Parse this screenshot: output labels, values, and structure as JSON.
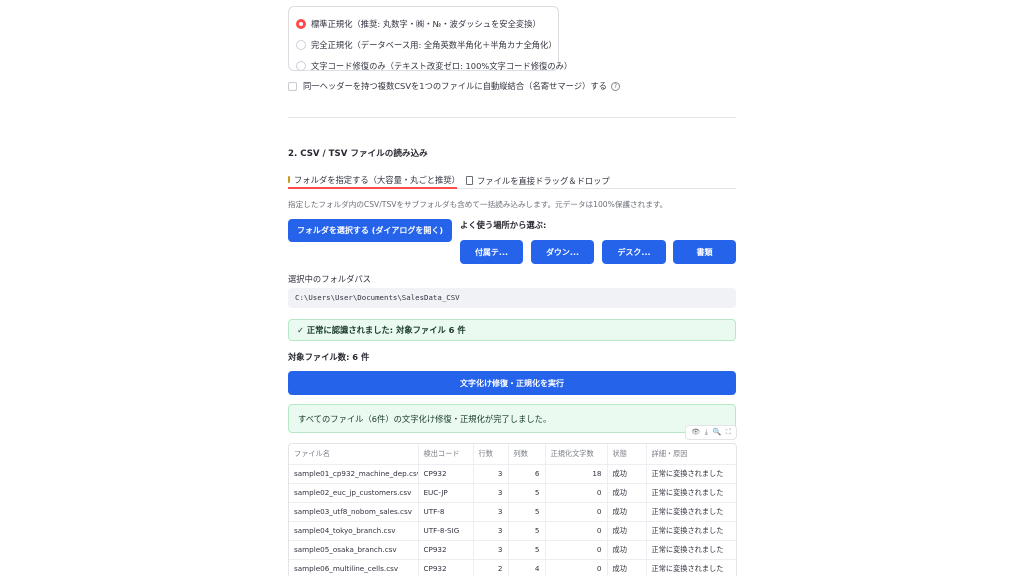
{
  "normalize_options": {
    "items": [
      {
        "label": "標準正規化（推奨: 丸数字・㈱・№・波ダッシュを安全変換）",
        "selected": true
      },
      {
        "label": "完全正規化（データベース用: 全角英数半角化＋半角カナ全角化）",
        "selected": false
      },
      {
        "label": "文字コード修復のみ（テキスト改変ゼロ: 100%文字コード修復のみ）",
        "selected": false
      }
    ]
  },
  "merge_option": {
    "label": "同一ヘッダーを持つ複数CSVを1つのファイルに自動縦結合（名寄せマージ）する",
    "checked": false,
    "help_icon": "?"
  },
  "section": {
    "title": "2. CSV / TSV ファイルの読み込み"
  },
  "tabs": [
    {
      "label": "フォルダを指定する（大容量・丸ごと推奨）",
      "icon": "folder-icon",
      "active": true
    },
    {
      "label": "ファイルを直接ドラッグ＆ドロップ",
      "icon": "document-icon",
      "active": false
    }
  ],
  "caption": "指定したフォルダ内のCSV/TSVをサブフォルダも含めて一括読み込みします。元データは100%保護されます。",
  "select_folder_button": "フォルダを選択する (ダイアログを開く)",
  "quick_places": {
    "label": "よく使う場所から選ぶ:",
    "buttons": [
      "付属テ...",
      "ダウン...",
      "デスク...",
      "書類"
    ]
  },
  "folder_path": {
    "label": "選択中のフォルダパス",
    "value": "C:\\Users\\User\\Documents\\SalesData_CSV"
  },
  "recognized_message": "✓ 正常に認識されました: 対象ファイル 6 件",
  "target_count": "対象ファイル数: 6 件",
  "run_button": "文字化け修復・正規化を実行",
  "complete_message": "すべてのファイル（6件）の文字化け修復・正規化が完了しました。",
  "table_toolbar": {
    "icons": [
      "eye-icon",
      "download-icon",
      "search-icon",
      "fullscreen-icon"
    ],
    "glyphs": [
      "👁",
      "⤓",
      "🔍",
      "⛶"
    ]
  },
  "results_table": {
    "headers": [
      "ファイル名",
      "検出コード",
      "行数",
      "列数",
      "正規化文字数",
      "状態",
      "詳細・原因"
    ],
    "rows": [
      [
        "sample01_cp932_machine_dep.csv",
        "CP932",
        "3",
        "6",
        "18",
        "成功",
        "正常に変換されました"
      ],
      [
        "sample02_euc_jp_customers.csv",
        "EUC-JP",
        "3",
        "5",
        "0",
        "成功",
        "正常に変換されました"
      ],
      [
        "sample03_utf8_nobom_sales.csv",
        "UTF-8",
        "3",
        "5",
        "0",
        "成功",
        "正常に変換されました"
      ],
      [
        "sample04_tokyo_branch.csv",
        "UTF-8-SIG",
        "3",
        "5",
        "0",
        "成功",
        "正常に変換されました"
      ],
      [
        "sample05_osaka_branch.csv",
        "CP932",
        "3",
        "5",
        "0",
        "成功",
        "正常に変換されました"
      ],
      [
        "sample06_multiline_cells.csv",
        "CP932",
        "2",
        "4",
        "0",
        "成功",
        "正常に変換されました"
      ]
    ]
  },
  "colors": {
    "primary": "#2563eb",
    "accent": "#ff4b4b",
    "success_bg": "#eafaf0"
  }
}
